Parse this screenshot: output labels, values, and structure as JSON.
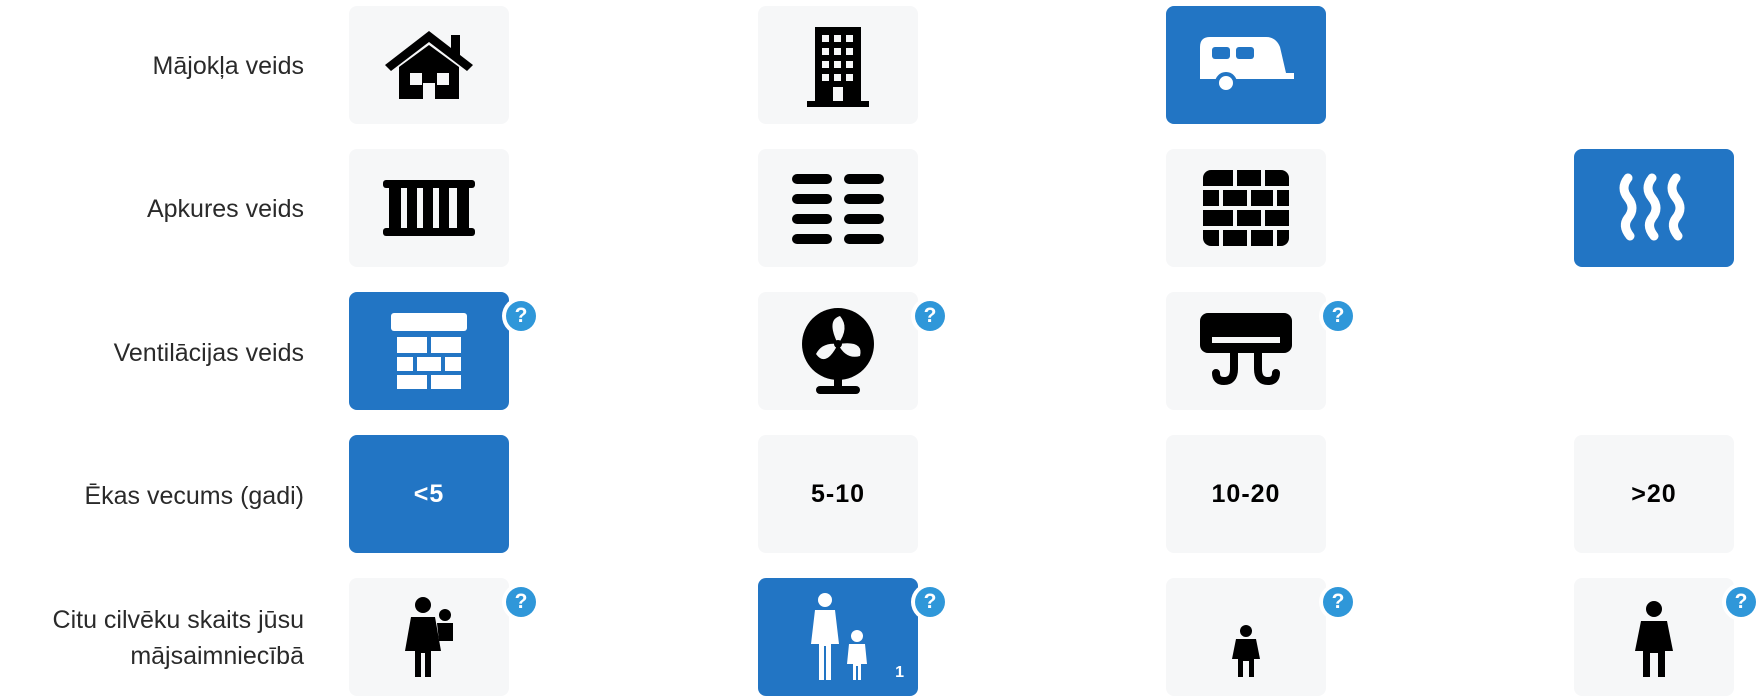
{
  "rows": [
    {
      "label": "Mājokļa veids"
    },
    {
      "label": "Apkures veids"
    },
    {
      "label": "Ventilācijas veids"
    },
    {
      "label": "Ēkas vecums (gadi)"
    },
    {
      "label_line1": "Citu cilvēku skaits jūsu",
      "label_line2": "mājsaimniecībā"
    }
  ],
  "housing_options": [
    {
      "icon": "house-icon",
      "selected": false
    },
    {
      "icon": "apartment-building-icon",
      "selected": false
    },
    {
      "icon": "caravan-icon",
      "selected": true
    }
  ],
  "heating_options": [
    {
      "icon": "radiator-icon",
      "selected": false
    },
    {
      "icon": "underfloor-heating-icon",
      "selected": false
    },
    {
      "icon": "stove-brick-icon",
      "selected": false
    },
    {
      "icon": "heat-waves-icon",
      "selected": true
    }
  ],
  "ventilation_options": [
    {
      "icon": "natural-ventilation-icon",
      "selected": true,
      "help": "?"
    },
    {
      "icon": "fan-icon",
      "selected": false,
      "help": "?"
    },
    {
      "icon": "air-conditioner-icon",
      "selected": false,
      "help": "?"
    }
  ],
  "age_options": [
    {
      "label": "<5",
      "selected": true
    },
    {
      "label": "5-10",
      "selected": false
    },
    {
      "label": "10-20",
      "selected": false
    },
    {
      "label": ">20",
      "selected": false
    }
  ],
  "household_options": [
    {
      "icon": "mother-carrying-child-icon",
      "selected": false,
      "help": "?"
    },
    {
      "icon": "adult-with-child-icon",
      "selected": true,
      "help": "?",
      "count": "1"
    },
    {
      "icon": "child-icon",
      "selected": false,
      "help": "?"
    },
    {
      "icon": "adult-icon",
      "selected": false,
      "help": "?"
    }
  ],
  "colors": {
    "accent": "#2275c4",
    "help": "#2f97d9",
    "tile_bg": "#f6f7f8"
  }
}
